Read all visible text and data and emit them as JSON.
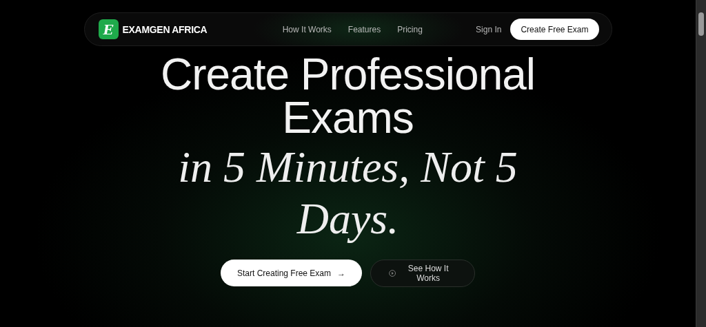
{
  "brand": {
    "logo_letter": "E",
    "name": "EXAMGEN AFRICA"
  },
  "nav": {
    "links": [
      "How It Works",
      "Features",
      "Pricing"
    ],
    "sign_in": "Sign In",
    "cta": "Create Free Exam"
  },
  "hero": {
    "headline_lines": [
      "Create Professional",
      "Exams"
    ],
    "highlight_lines": [
      "in 5 Minutes, Not 5",
      "Days."
    ],
    "primary_button": {
      "label": "Start Creating Free Exam",
      "icon": "→"
    },
    "secondary_button": {
      "label": "See How It Works"
    }
  }
}
